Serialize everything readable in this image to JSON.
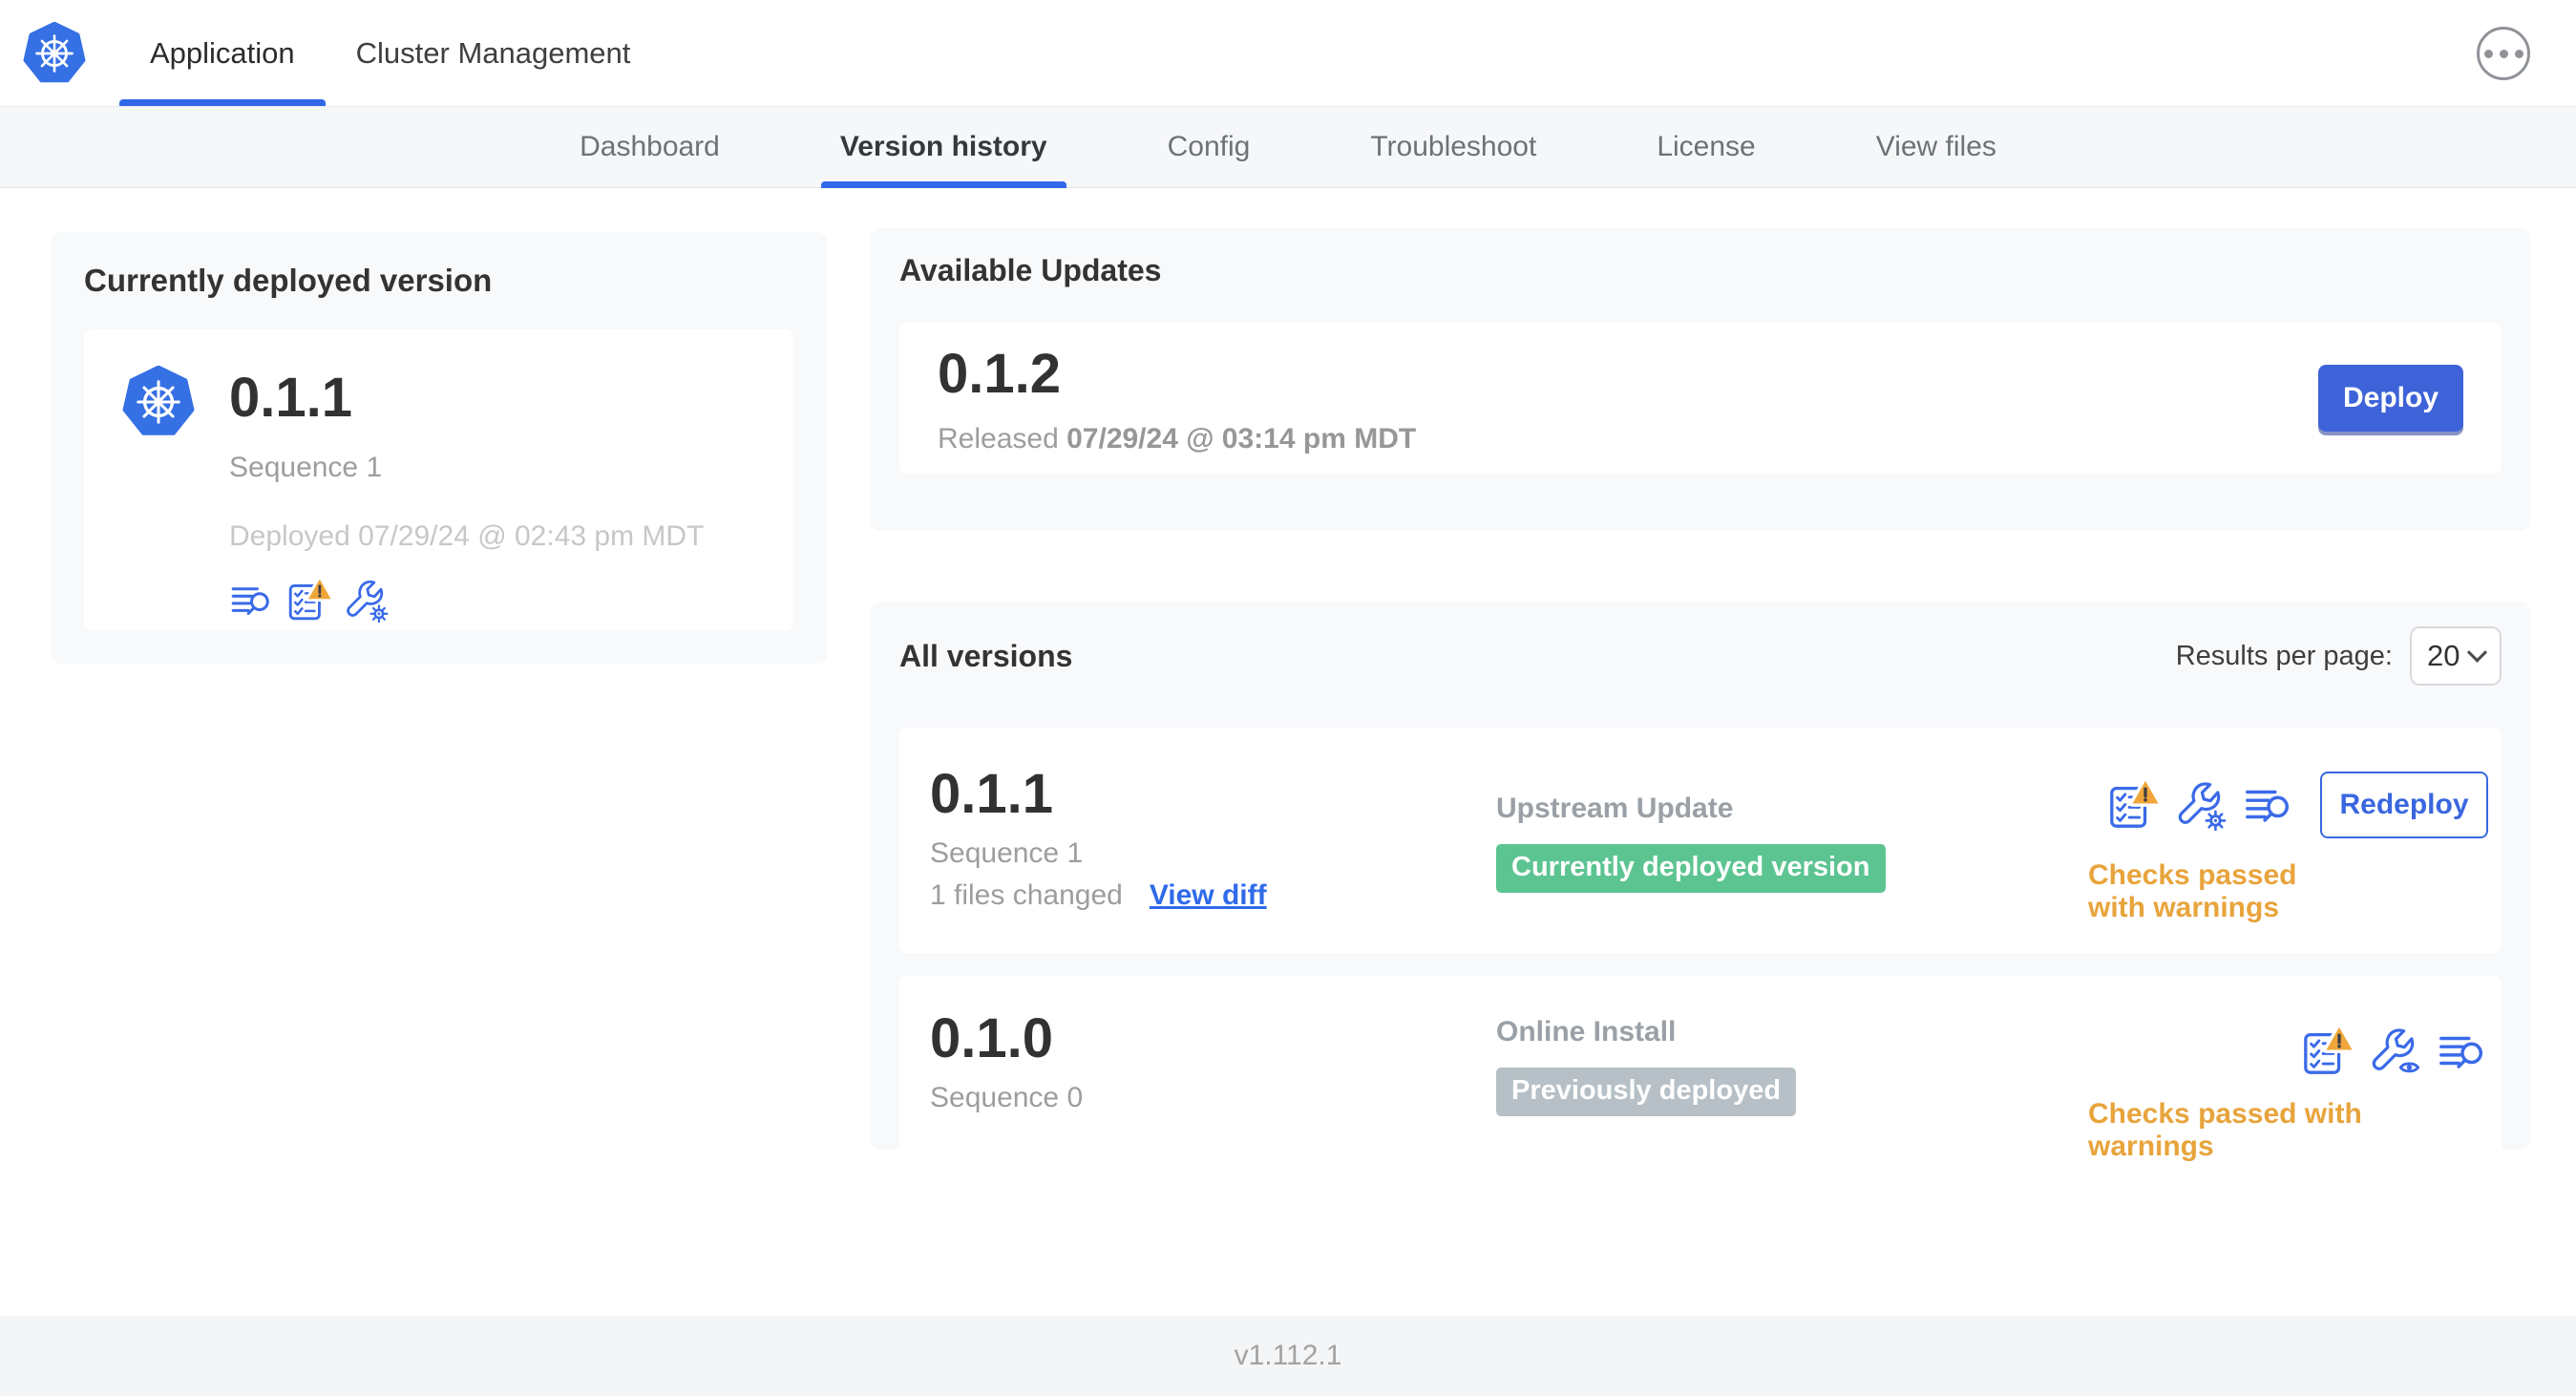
{
  "colors": {
    "accent_blue": "#3268e8",
    "deploy_button_blue": "#3e63d8",
    "kubernetes_blue": "#3570e4",
    "success_badge_green": "#5cc491",
    "muted_badge_gray": "#b6c0c6",
    "warning_orange": "#e8a43c",
    "text_dark": "#323232",
    "text_gray": "#9d9d9d",
    "text_light_gray": "#c7c7c7"
  },
  "header": {
    "logo_icon": "kubernetes-logo",
    "tabs": [
      {
        "label": "Application",
        "active": true
      },
      {
        "label": "Cluster Management",
        "active": false
      }
    ],
    "more_button_icon": "ellipsis-icon"
  },
  "subnav": {
    "tabs": [
      {
        "label": "Dashboard",
        "active": false
      },
      {
        "label": "Version history",
        "active": true
      },
      {
        "label": "Config",
        "active": false
      },
      {
        "label": "Troubleshoot",
        "active": false
      },
      {
        "label": "License",
        "active": false
      },
      {
        "label": "View files",
        "active": false
      }
    ]
  },
  "current_version": {
    "title": "Currently deployed version",
    "version": "0.1.1",
    "sequence": "Sequence 1",
    "deployed": "Deployed 07/29/24 @ 02:43 pm MDT",
    "icons": [
      "logs-search-icon",
      "preflight-warning-icon",
      "config-edit-icon"
    ]
  },
  "available_updates": {
    "title": "Available Updates",
    "version": "0.1.2",
    "released_prefix": "Released",
    "released_date": "07/29/24 @ 03:14 pm MDT",
    "deploy_button": "Deploy"
  },
  "all_versions": {
    "title": "All versions",
    "results_per_page_label": "Results per page:",
    "results_per_page_value": "20",
    "rows": [
      {
        "version": "0.1.1",
        "sequence": "Sequence 1",
        "files_changed": "1 files changed",
        "view_diff_link": "View diff",
        "source": "Upstream Update",
        "badge": "Currently deployed version",
        "badge_color": "#5cc491",
        "icons": [
          "preflight-warning-icon",
          "config-edit-icon",
          "logs-search-icon"
        ],
        "action_button": "Redeploy",
        "status": "Checks passed with warnings"
      },
      {
        "version": "0.1.0",
        "sequence": "Sequence 0",
        "source": "Online Install",
        "badge": "Previously deployed",
        "badge_color": "#b6c0c6",
        "icons": [
          "preflight-warning-icon",
          "config-view-icon",
          "logs-search-icon"
        ],
        "status": "Checks passed with warnings"
      }
    ]
  },
  "footer": {
    "app_version": "v1.112.1"
  }
}
